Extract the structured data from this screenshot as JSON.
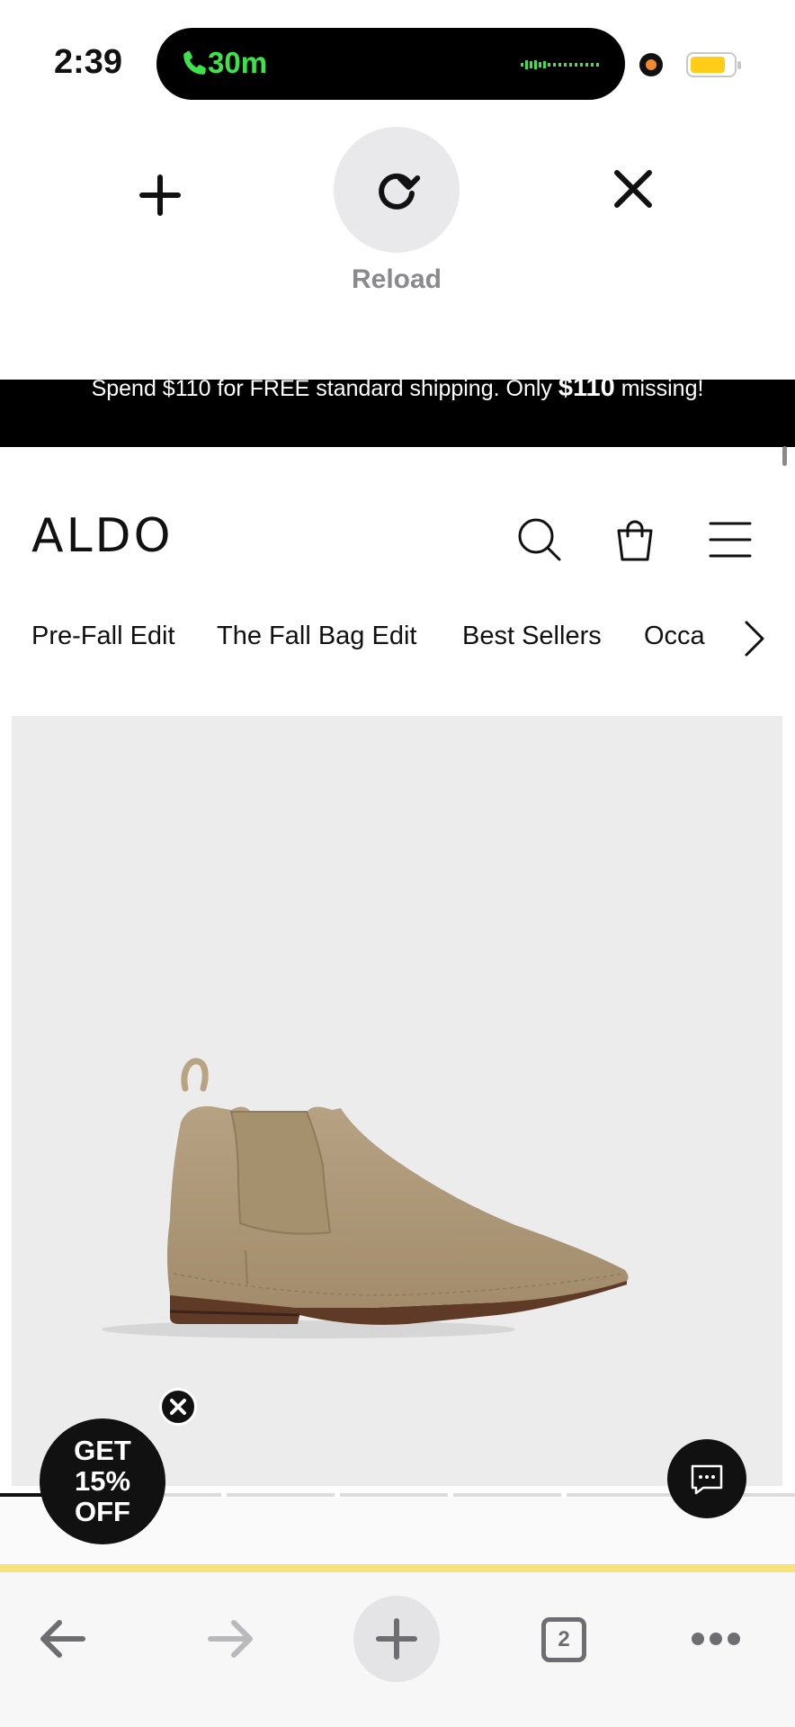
{
  "status_bar": {
    "time": "2:39",
    "call_duration": "30m",
    "colors": {
      "call_green": "#3ee34a",
      "battery": "#ffcc17",
      "recording_dot": "#f18a2e"
    }
  },
  "refresh_menu": {
    "reload_label": "Reload",
    "icons": [
      "plus-icon",
      "reload-icon",
      "close-icon"
    ]
  },
  "promo_banner": {
    "text_before": "Spend $110 for FREE standard shipping. Only ",
    "amount": "$110",
    "text_after": " missing!"
  },
  "header": {
    "logo": "ALDO",
    "icons": [
      "search-icon",
      "shopping-bag-icon",
      "menu-icon"
    ]
  },
  "nav": {
    "items": [
      "Pre-Fall Edit",
      "The Fall Bag Edit",
      "Best Sellers",
      "Occa"
    ]
  },
  "product": {
    "image": "tan-suede-chelsea-boot",
    "gallery_count": 7,
    "gallery_active": 1
  },
  "discount_popup": {
    "line1": "GET",
    "line2": "15%",
    "line3": "OFF"
  },
  "browser_toolbar": {
    "tab_count": "2",
    "icons": [
      "back-arrow-icon",
      "forward-arrow-icon",
      "new-tab-icon",
      "tabs-icon",
      "more-icon"
    ]
  }
}
